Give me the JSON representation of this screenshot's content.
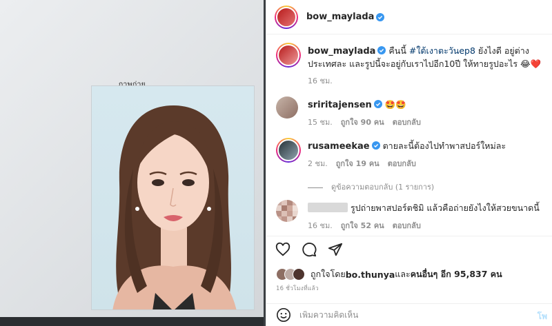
{
  "photo": {
    "caption": "ภาพถ่าย"
  },
  "header": {
    "username": "bow_maylada"
  },
  "caption": {
    "username": "bow_maylada",
    "text_before": " คืนนี้ ",
    "hashtag": "#ใต้เงาตะวันep8",
    "text_after": " ยังไงดี อยู่ต่างประเทศละ และรูปนี้จะอยู่กับเราไปอีก10ปี ให้ทายรูปอะไร 😂❤️",
    "time": "16 ชม."
  },
  "comments": [
    {
      "username": "sriritajensen",
      "text": " 🤩🤩",
      "time": "15 ชม.",
      "likes": "ถูกใจ 90 คน",
      "reply": "ตอบกลับ"
    },
    {
      "username": "rusameekae",
      "text": " ตายละนี้ต้องไปทำพาสปอร์ใหม่ละ",
      "time": "2 ชม.",
      "likes": "ถูกใจ 19 คน",
      "reply": "ตอบกลับ"
    },
    {
      "username": "",
      "text": "รูปถ่ายพาสปอร์ตชิมิ แล้วคือถ่ายยังไงให้สวยขนาดนี้",
      "time": "16 ชม.",
      "likes": "ถูกใจ 52 คน",
      "reply": "ตอบกลับ"
    }
  ],
  "view_replies": "ดูข้อความตอบกลับ (1 รายการ)",
  "actions": {
    "like_icon": "heart-icon",
    "comment_icon": "comment-icon",
    "share_icon": "share-icon"
  },
  "likes": {
    "prefix": "ถูกใจโดย ",
    "first_liker": "bo.thunya",
    "middle": " และ",
    "others": "คนอื่นๆ อีก 95,837 คน"
  },
  "time_ago": "16 ชั่วโมงที่แล้ว",
  "add_comment": {
    "placeholder": "เพิ่มความคิดเห็น",
    "post_label": "โพ"
  },
  "colors": {
    "link": "#00376b",
    "verified": "#3897f0",
    "muted": "#8e8e8e",
    "post_button": "#b2dffc"
  }
}
